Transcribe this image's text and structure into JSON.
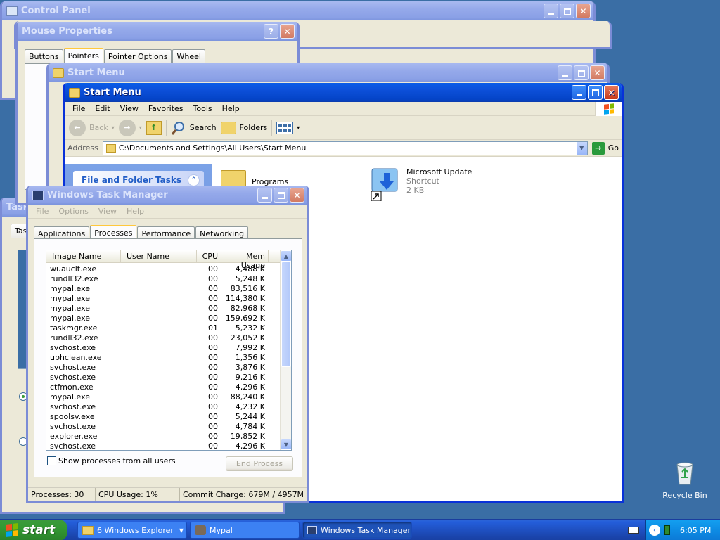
{
  "desktop": {
    "recycle_bin_label": "Recycle Bin"
  },
  "windows": {
    "control_panel": {
      "title": "Control Panel"
    },
    "mouse_properties": {
      "title": "Mouse Properties",
      "tabs": [
        "Buttons",
        "Pointers",
        "Pointer Options",
        "Wheel"
      ],
      "selected_tab": "Pointers"
    },
    "start_menu_back": {
      "title": "Start Menu"
    },
    "start_menu": {
      "title": "Start Menu",
      "menu": [
        "File",
        "Edit",
        "View",
        "Favorites",
        "Tools",
        "Help"
      ],
      "toolbar": {
        "back": "Back",
        "search": "Search",
        "folders": "Folders"
      },
      "address_label": "Address",
      "address_value": "C:\\Documents and Settings\\All Users\\Start Menu",
      "go_label": "Go",
      "task_pane_title": "File and Folder Tasks",
      "items": [
        {
          "name": "Programs"
        },
        {
          "name": "Microsoft Update",
          "type": "Shortcut",
          "size": "2 KB"
        }
      ]
    },
    "task_manager": {
      "title": "Windows Task Manager",
      "menu": [
        "File",
        "Options",
        "View",
        "Help"
      ],
      "tabs": [
        "Applications",
        "Processes",
        "Performance",
        "Networking"
      ],
      "selected_tab": "Processes",
      "columns": [
        "Image Name",
        "User Name",
        "CPU",
        "Mem Usage"
      ],
      "processes": [
        [
          "wuauclt.exe",
          "",
          "00",
          "4,488 K"
        ],
        [
          "rundll32.exe",
          "",
          "00",
          "5,248 K"
        ],
        [
          "mypal.exe",
          "",
          "00",
          "83,516 K"
        ],
        [
          "mypal.exe",
          "",
          "00",
          "114,380 K"
        ],
        [
          "mypal.exe",
          "",
          "00",
          "82,968 K"
        ],
        [
          "mypal.exe",
          "",
          "00",
          "159,692 K"
        ],
        [
          "taskmgr.exe",
          "",
          "01",
          "5,232 K"
        ],
        [
          "rundll32.exe",
          "",
          "00",
          "23,052 K"
        ],
        [
          "svchost.exe",
          "",
          "00",
          "7,992 K"
        ],
        [
          "uphclean.exe",
          "",
          "00",
          "1,356 K"
        ],
        [
          "svchost.exe",
          "",
          "00",
          "3,876 K"
        ],
        [
          "svchost.exe",
          "",
          "00",
          "9,216 K"
        ],
        [
          "ctfmon.exe",
          "",
          "00",
          "4,296 K"
        ],
        [
          "mypal.exe",
          "",
          "00",
          "88,240 K"
        ],
        [
          "svchost.exe",
          "",
          "00",
          "4,232 K"
        ],
        [
          "spoolsv.exe",
          "",
          "00",
          "5,244 K"
        ],
        [
          "svchost.exe",
          "",
          "00",
          "4,784 K"
        ],
        [
          "explorer.exe",
          "",
          "00",
          "19,852 K"
        ],
        [
          "svchost.exe",
          "",
          "00",
          "4,296 K"
        ]
      ],
      "show_all_label": "Show processes from all users",
      "end_process_label": "End Process",
      "status": {
        "processes": "Processes: 30",
        "cpu": "CPU Usage: 1%",
        "commit": "Commit Charge: 679M / 4957M"
      }
    },
    "task_back": {
      "title": "Task",
      "tab": "Tas"
    }
  },
  "taskbar": {
    "start_label": "start",
    "tasks": [
      {
        "label": "6 Windows Explorer",
        "active": false
      },
      {
        "label": "Mypal",
        "active": false
      },
      {
        "label": "Windows Task Manager",
        "active": true
      }
    ],
    "clock": "6:05 PM"
  }
}
